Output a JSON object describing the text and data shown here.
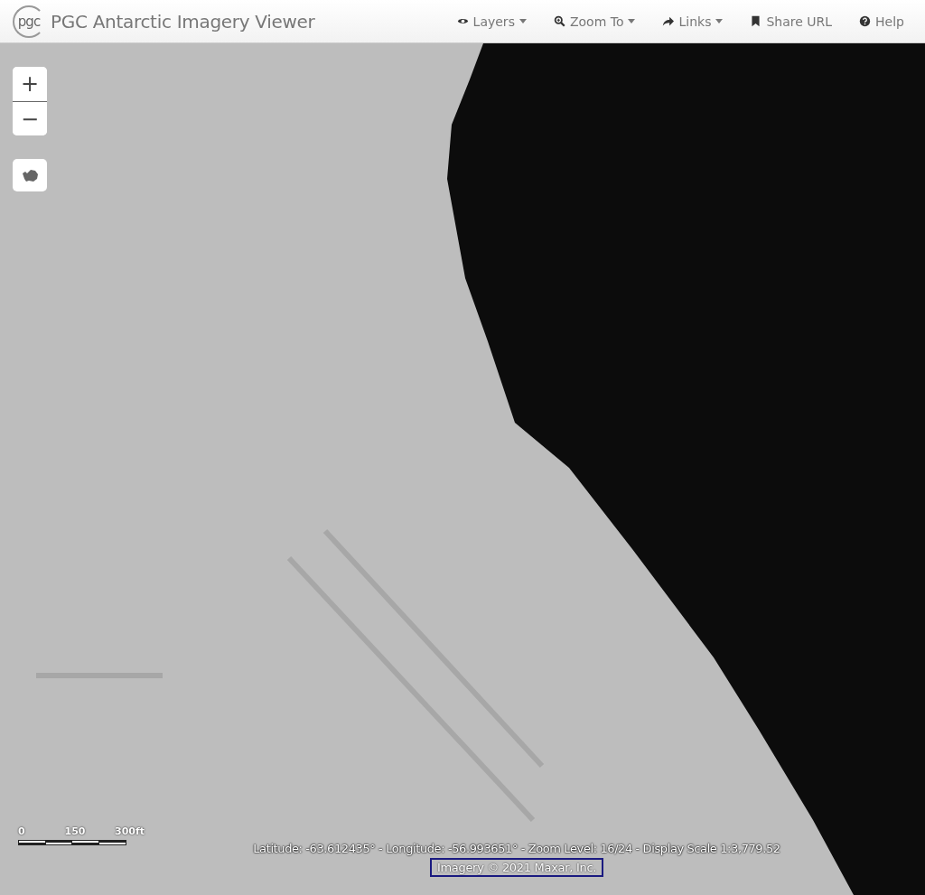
{
  "header": {
    "logo": "pgc",
    "title": "PGC Antarctic Imagery Viewer",
    "nav": [
      {
        "label": "Layers",
        "dropdown": true
      },
      {
        "label": "Zoom To",
        "dropdown": true
      },
      {
        "label": "Links",
        "dropdown": true
      },
      {
        "label": "Share URL",
        "dropdown": false
      },
      {
        "label": "Help",
        "dropdown": false
      }
    ]
  },
  "map_controls": {
    "zoom_in": "+",
    "zoom_out": "−"
  },
  "scale_bar": {
    "labels": [
      "0",
      "150",
      "300ft"
    ]
  },
  "status": "Latitude: -63.612435° - Longitude: -56.993651° - Zoom Level: 16/24 - Display Scale 1:3,779.52",
  "attribution": "Imagery © 2021 Maxar, Inc."
}
